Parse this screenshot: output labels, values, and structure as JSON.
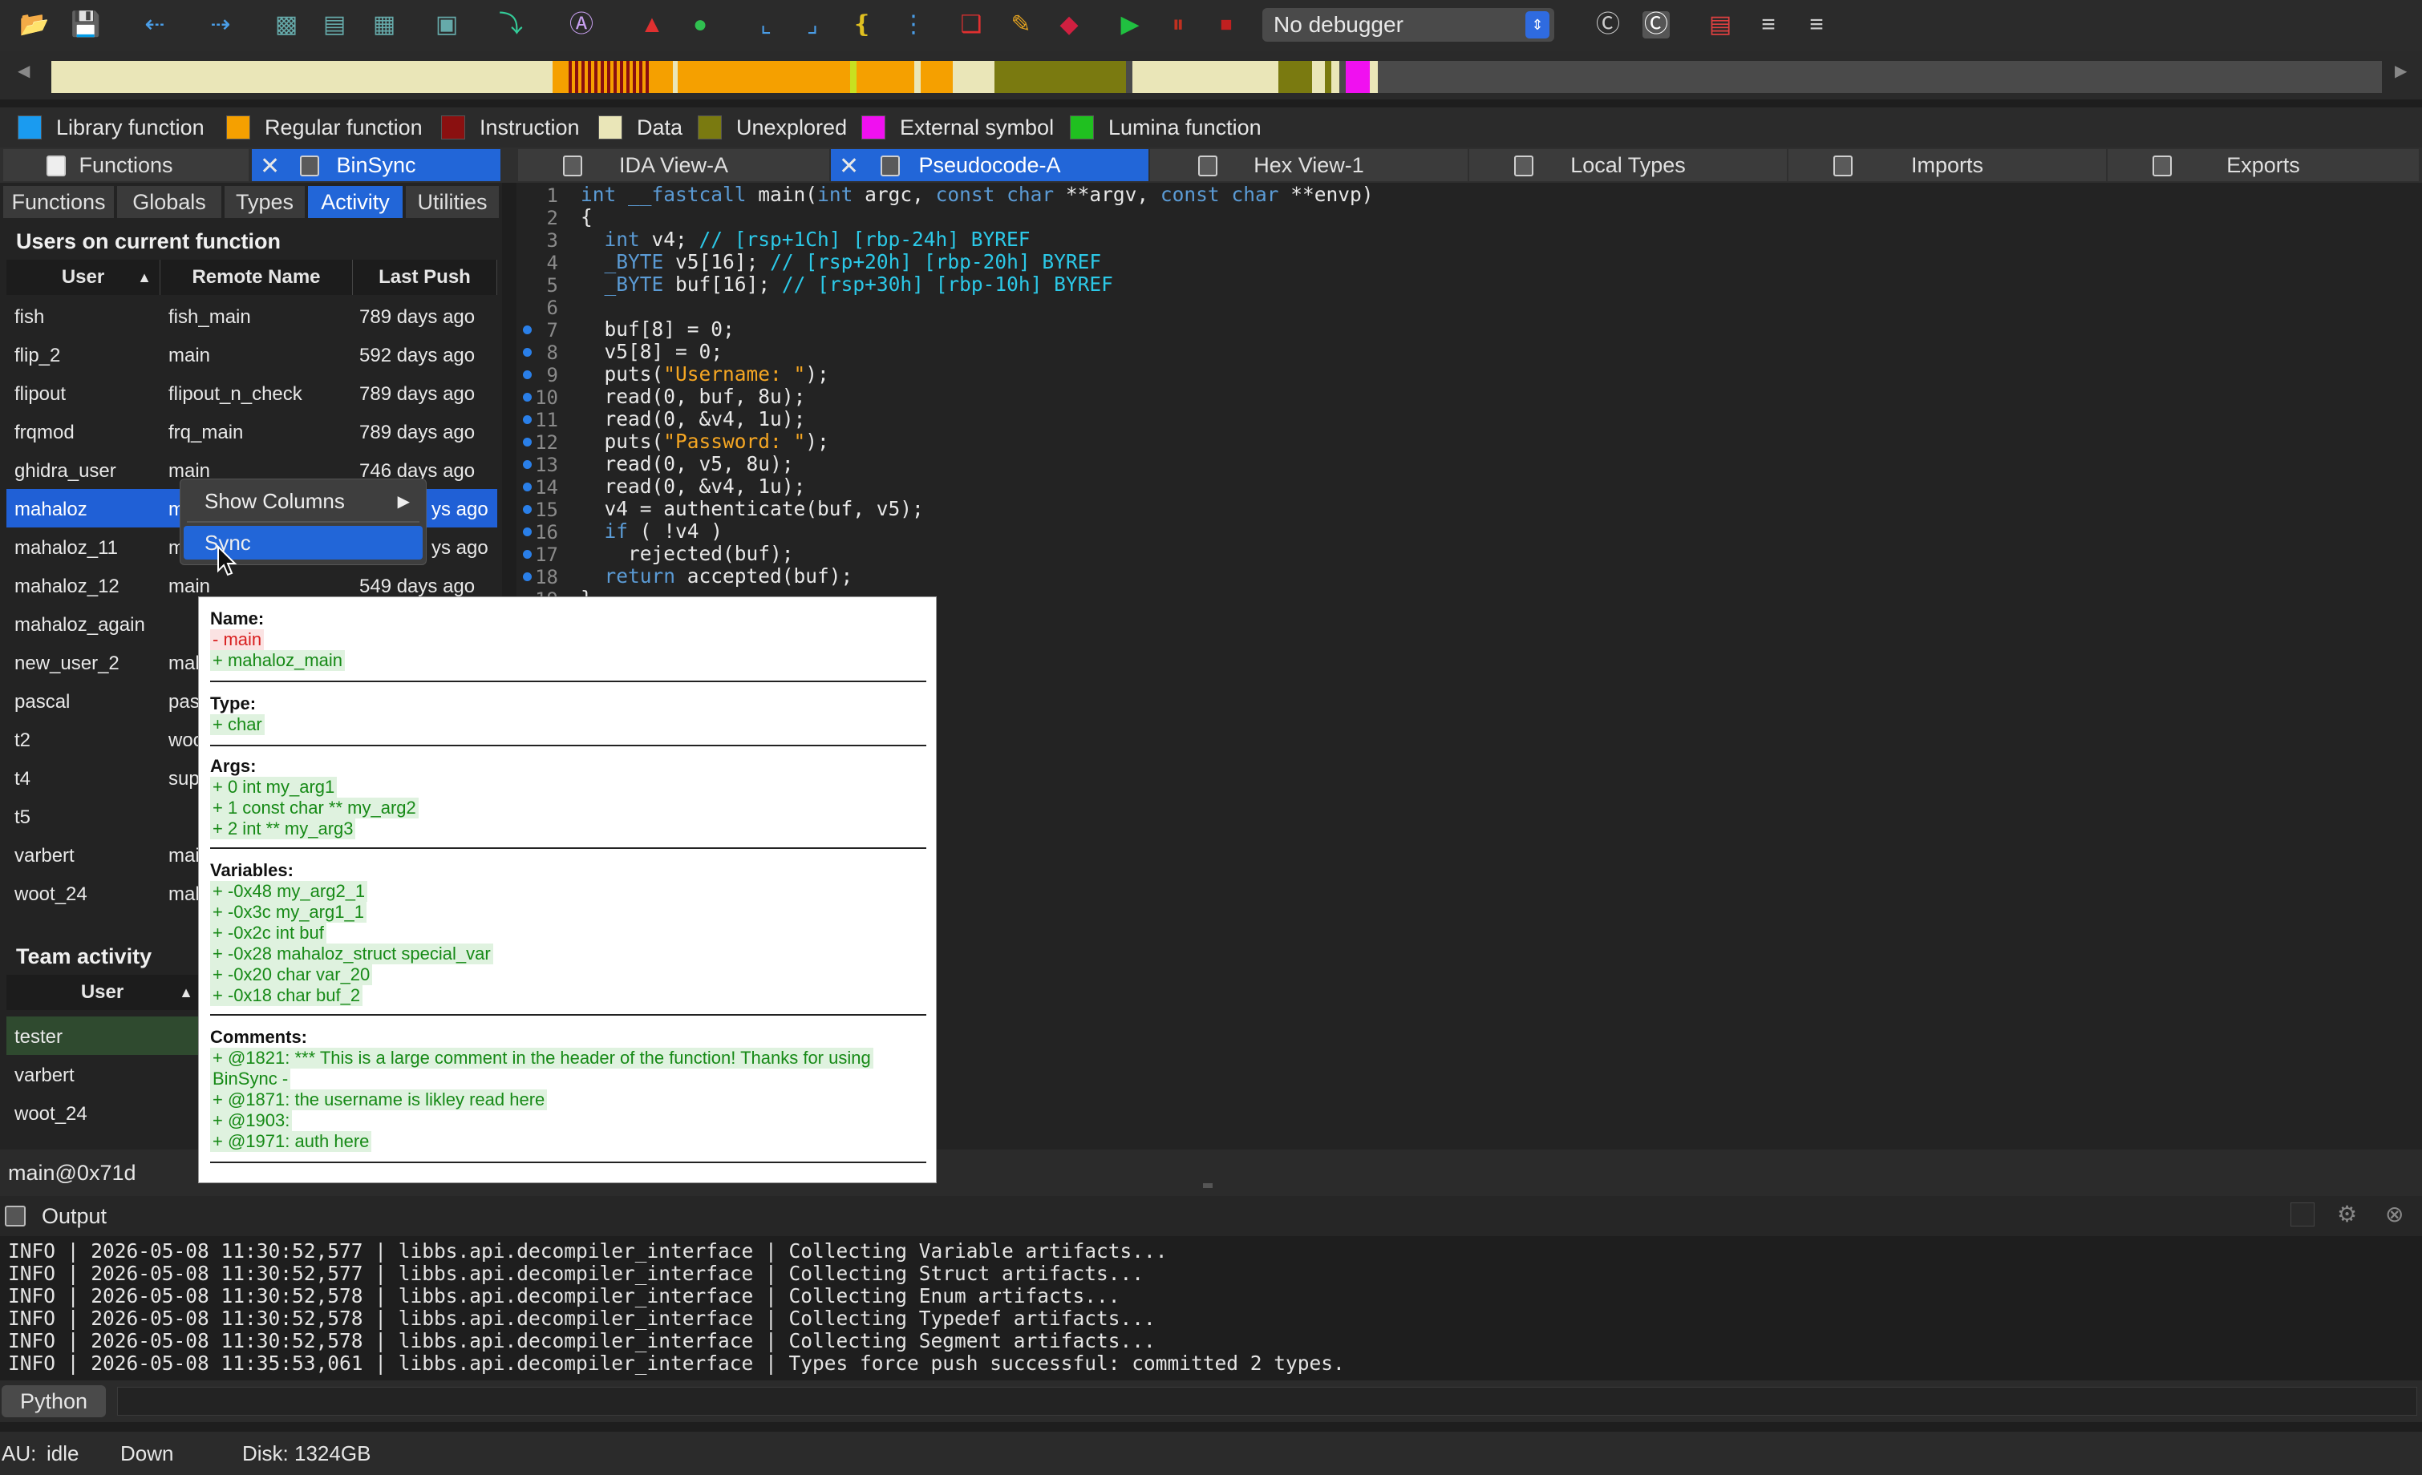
{
  "toolbar": {
    "debugger_label": "No debugger"
  },
  "legend": [
    {
      "label": "Library function",
      "color": "#1a9bf0"
    },
    {
      "label": "Regular function",
      "color": "#f5a000"
    },
    {
      "label": "Instruction",
      "color": "#8a1010"
    },
    {
      "label": "Data",
      "color": "#eae6b8"
    },
    {
      "label": "Unexplored",
      "color": "#7a7a10"
    },
    {
      "label": "External symbol",
      "color": "#f010f0"
    },
    {
      "label": "Lumina function",
      "color": "#20c020"
    }
  ],
  "tabs": {
    "left": [
      {
        "label": "Functions"
      },
      {
        "label": "BinSync"
      }
    ],
    "main": [
      {
        "label": "IDA View-A"
      },
      {
        "label": "Pseudocode-A"
      },
      {
        "label": "Hex View-1"
      },
      {
        "label": "Local Types"
      },
      {
        "label": "Imports"
      },
      {
        "label": "Exports"
      }
    ]
  },
  "binsync": {
    "subtabs": [
      "Functions",
      "Globals",
      "Types",
      "Activity",
      "Utilities"
    ],
    "users_title": "Users on current function",
    "columns": [
      "User",
      "Remote Name",
      "Last Push"
    ],
    "users": [
      {
        "user": "fish",
        "remote": "fish_main",
        "push": "789 days ago"
      },
      {
        "user": "flip_2",
        "remote": "main",
        "push": "592 days ago"
      },
      {
        "user": "flipout",
        "remote": "flipout_n_check",
        "push": "789 days ago"
      },
      {
        "user": "frqmod",
        "remote": "frq_main",
        "push": "789 days ago"
      },
      {
        "user": "ghidra_user",
        "remote": "main",
        "push": "746 days ago"
      },
      {
        "user": "mahaloz",
        "remote": "m",
        "push": "ys ago"
      },
      {
        "user": "mahaloz_11",
        "remote": "m",
        "push": "ys ago"
      },
      {
        "user": "mahaloz_12",
        "remote": "main",
        "push": "549 days ago"
      },
      {
        "user": "mahaloz_again",
        "remote": "",
        "push": ""
      },
      {
        "user": "new_user_2",
        "remote": "mah",
        "push": ""
      },
      {
        "user": "pascal",
        "remote": "pas",
        "push": ""
      },
      {
        "user": "t2",
        "remote": "woo",
        "push": ""
      },
      {
        "user": "t4",
        "remote": "sup",
        "push": ""
      },
      {
        "user": "t5",
        "remote": "",
        "push": ""
      },
      {
        "user": "varbert",
        "remote": "mai",
        "push": ""
      },
      {
        "user": "woot_24",
        "remote": "mah",
        "push": ""
      }
    ],
    "team_title": "Team activity",
    "team_column": "User",
    "team": [
      {
        "user": "tester"
      },
      {
        "user": "varbert"
      },
      {
        "user": "woot_24"
      }
    ]
  },
  "code": {
    "lines": [
      "int __fastcall main(int argc, const char **argv, const char **envp)",
      "{",
      "  int v4; // [rsp+1Ch] [rbp-24h] BYREF",
      "  _BYTE v5[16]; // [rsp+20h] [rbp-20h] BYREF",
      "  _BYTE buf[16]; // [rsp+30h] [rbp-10h] BYREF",
      "",
      "  buf[8] = 0;",
      "  v5[8] = 0;",
      "  puts(\"Username: \");",
      "  read(0, buf, 8u);",
      "  read(0, &v4, 1u);",
      "  puts(\"Password: \");",
      "  read(0, v5, 8u);",
      "  read(0, &v4, 1u);",
      "  v4 = authenticate(buf, v5);",
      "  if ( !v4 )",
      "    rejected(buf);",
      "  return accepted(buf);",
      "}"
    ]
  },
  "context_menu": {
    "items": [
      {
        "label": "Show Columns",
        "has_submenu": true
      },
      {
        "label": "Sync",
        "has_submenu": false
      }
    ]
  },
  "tooltip": {
    "name_header": "Name:",
    "name_removed": "- main",
    "name_added": "+ mahaloz_main",
    "type_header": "Type:",
    "type_added": "+ char",
    "args_header": "Args:",
    "args": [
      "+ 0 int my_arg1",
      "+ 1 const char ** my_arg2",
      "+ 2 int ** my_arg3"
    ],
    "vars_header": "Variables:",
    "vars": [
      "+ -0x48 my_arg2_1",
      "+ -0x3c my_arg1_1",
      "+ -0x2c int buf",
      "+ -0x28 mahaloz_struct special_var",
      "+ -0x20 char var_20",
      "+ -0x18 char buf_2"
    ],
    "comments_header": "Comments:",
    "comments": [
      "+ @1821: *** This is a large comment in the header of the function! Thanks for using",
      "BinSync -",
      "+ @1871: the username is likley read here",
      "+ @1903:",
      "+ @1971: auth here"
    ]
  },
  "location": "main@0x71d",
  "output": {
    "title": "Output",
    "lines": [
      "INFO | 2026-05-08 11:30:52,577 | libbs.api.decompiler_interface | Collecting Variable artifacts...",
      "INFO | 2026-05-08 11:30:52,577 | libbs.api.decompiler_interface | Collecting Struct artifacts...",
      "INFO | 2026-05-08 11:30:52,578 | libbs.api.decompiler_interface | Collecting Enum artifacts...",
      "INFO | 2026-05-08 11:30:52,578 | libbs.api.decompiler_interface | Collecting Typedef artifacts...",
      "INFO | 2026-05-08 11:30:52,578 | libbs.api.decompiler_interface | Collecting Segment artifacts...",
      "INFO | 2026-05-08 11:35:53,061 | libbs.api.decompiler_interface | Types force push successful: committed 2 types."
    ],
    "python_button": "Python"
  },
  "status": {
    "au": "AU:",
    "au_state": "idle",
    "direction": "Down",
    "disk": "Disk: 1324GB"
  }
}
